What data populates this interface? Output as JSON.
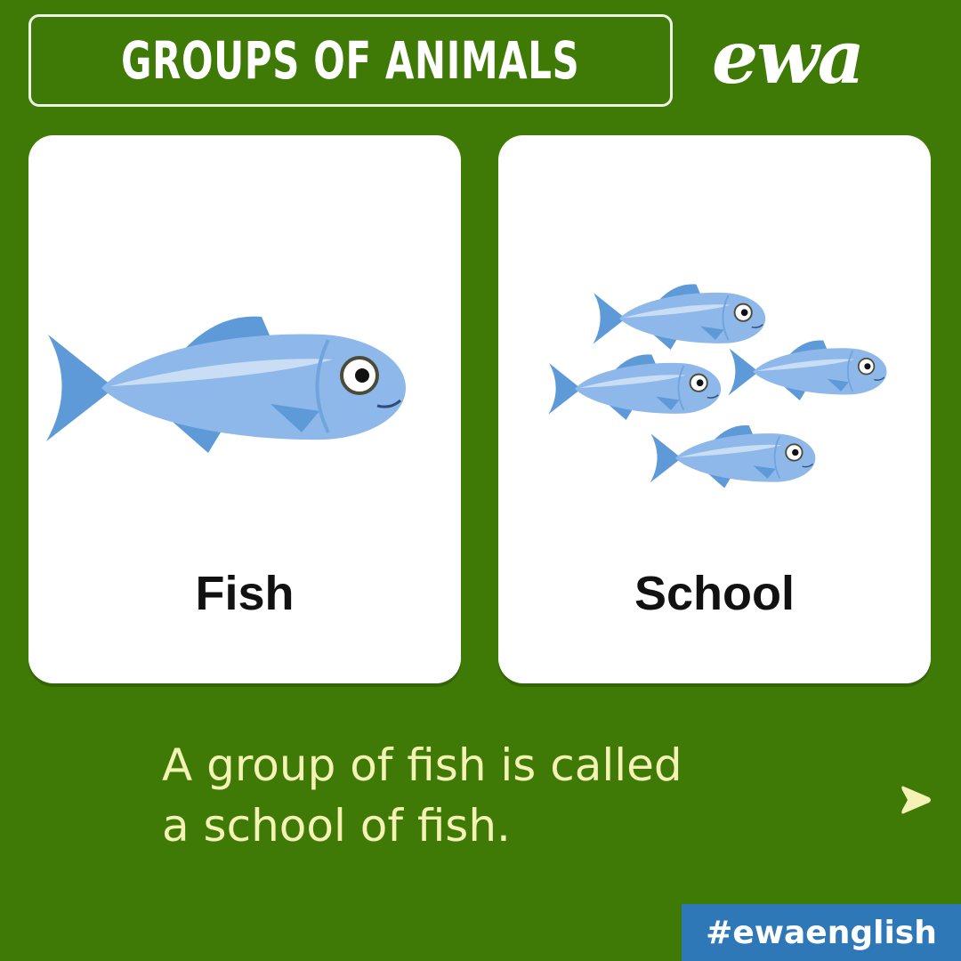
{
  "header": {
    "title": "GROUPS OF ANIMALS",
    "brand": "ewa"
  },
  "cards": [
    {
      "label": "Fish",
      "illustration": "single-fish-icon"
    },
    {
      "label": "School",
      "illustration": "fish-school-icon"
    }
  ],
  "caption": {
    "line1": "A group of fish is called",
    "line2": "a school of fish."
  },
  "next_icon": "next-arrow-icon",
  "hashtag": "#ewaenglish",
  "colors": {
    "background": "#3f7a07",
    "caption": "#f4f2b4",
    "fish": "#8fb8ea",
    "hashtag_bg": "#2e78b8"
  }
}
